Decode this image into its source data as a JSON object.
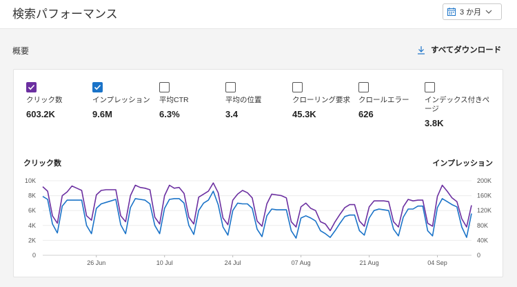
{
  "header": {
    "title": "検索パフォーマンス",
    "date_range": "3 か月"
  },
  "section": {
    "label": "概要",
    "download_label": "すべてダウンロード"
  },
  "metrics": [
    {
      "label": "クリック数",
      "value": "603.2K",
      "checked": true,
      "color": "#6b2fa0"
    },
    {
      "label": "インプレッション",
      "value": "9.6M",
      "checked": true,
      "color": "#1a73c8"
    },
    {
      "label": "平均CTR",
      "value": "6.3%",
      "checked": false
    },
    {
      "label": "平均の位置",
      "value": "3.4",
      "checked": false
    },
    {
      "label": "クローリング要求",
      "value": "45.3K",
      "checked": false
    },
    {
      "label": "クロールエラー",
      "value": "626",
      "checked": false
    },
    {
      "label": "インデックス付きページ",
      "value": "3.8K",
      "checked": false
    }
  ],
  "chart_data": {
    "type": "line",
    "xlabel": "",
    "x_tick_labels": [
      "26 Jun",
      "10 Jul",
      "24 Jul",
      "07 Aug",
      "21 Aug",
      "04 Sep"
    ],
    "x_tick_indices": [
      11,
      25,
      39,
      53,
      67,
      81
    ],
    "left_axis": {
      "title": "クリック数",
      "ylim": [
        0,
        10000
      ],
      "ticks": [
        "0",
        "2K",
        "4K",
        "6K",
        "8K",
        "10K"
      ]
    },
    "right_axis": {
      "title": "インプレッション",
      "ylim": [
        0,
        200000
      ],
      "ticks": [
        "0",
        "40K",
        "80K",
        "120K",
        "160K",
        "200K"
      ]
    },
    "series": [
      {
        "name": "クリック数",
        "axis": "left",
        "color": "#6b2fa0",
        "values": [
          9200,
          8600,
          5300,
          4300,
          8000,
          8500,
          9300,
          9000,
          8700,
          5300,
          4700,
          8100,
          8700,
          8800,
          8800,
          8800,
          5300,
          4500,
          8000,
          9400,
          9100,
          9000,
          8800,
          5100,
          4200,
          8000,
          9400,
          9000,
          9100,
          8300,
          5100,
          4200,
          7800,
          8200,
          8600,
          9700,
          8400,
          5000,
          4100,
          7400,
          8200,
          8700,
          8400,
          7700,
          4600,
          3900,
          6900,
          8200,
          8100,
          8000,
          7700,
          4500,
          3800,
          6500,
          7000,
          6300,
          6000,
          4500,
          4200,
          3300,
          4500,
          5500,
          6400,
          6800,
          6800,
          4600,
          3900,
          6500,
          7300,
          7300,
          7300,
          7200,
          4500,
          3800,
          6500,
          7500,
          7300,
          7400,
          7400,
          4300,
          3900,
          7900,
          9400,
          8600,
          7700,
          7200,
          4900,
          3800,
          6700
        ]
      },
      {
        "name": "インプレッション",
        "axis": "right",
        "color": "#1a73c8",
        "values": [
          158000,
          150000,
          84000,
          60000,
          132000,
          148000,
          148000,
          148000,
          148000,
          80000,
          58000,
          126000,
          138000,
          142000,
          146000,
          150000,
          82000,
          58000,
          128000,
          152000,
          150000,
          148000,
          138000,
          80000,
          58000,
          126000,
          150000,
          152000,
          152000,
          140000,
          80000,
          56000,
          120000,
          140000,
          148000,
          172000,
          136000,
          76000,
          54000,
          120000,
          140000,
          138000,
          138000,
          126000,
          70000,
          50000,
          106000,
          124000,
          122000,
          122000,
          122000,
          66000,
          46000,
          100000,
          106000,
          100000,
          92000,
          66000,
          58000,
          48000,
          66000,
          86000,
          104000,
          108000,
          108000,
          66000,
          54000,
          100000,
          120000,
          124000,
          122000,
          120000,
          70000,
          52000,
          102000,
          124000,
          124000,
          132000,
          132000,
          66000,
          52000,
          128000,
          152000,
          144000,
          136000,
          130000,
          76000,
          48000,
          112000
        ]
      }
    ]
  }
}
